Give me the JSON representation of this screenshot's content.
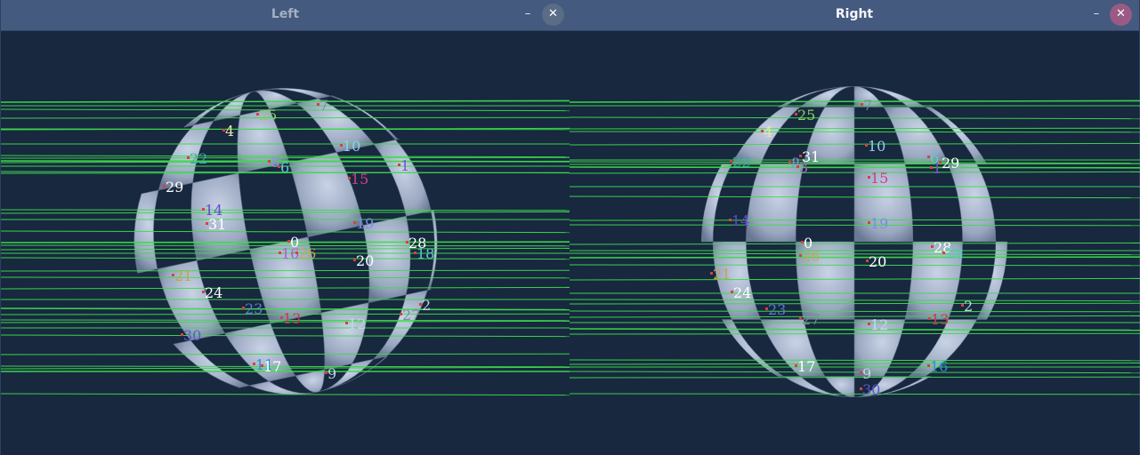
{
  "windows": {
    "left": {
      "title": "Left",
      "minimize_glyph": "–",
      "close_glyph": "✕",
      "points": [
        {
          "id": "7",
          "c": "#7f8aa4"
        },
        {
          "id": "25",
          "c": "#8ad15c"
        },
        {
          "id": "4",
          "c": "#e6e6a6"
        },
        {
          "id": "10",
          "c": "#8ecdf0"
        },
        {
          "id": "22",
          "c": "#3fa6b7"
        },
        {
          "id": "8",
          "c": "#8f8ee6"
        },
        {
          "id": "6",
          "c": "#5fc6d8"
        },
        {
          "id": "15",
          "c": "#d03e8a"
        },
        {
          "id": "1",
          "c": "#7b4fd6"
        },
        {
          "id": "29",
          "c": "#ffffff"
        },
        {
          "id": "14",
          "c": "#6846d6"
        },
        {
          "id": "31",
          "c": "#ffffff"
        },
        {
          "id": "19",
          "c": "#7a8fe4"
        },
        {
          "id": "0",
          "c": "#ffffff"
        },
        {
          "id": "16",
          "c": "#b05ad0"
        },
        {
          "id": "26",
          "c": "#c6a65a"
        },
        {
          "id": "28",
          "c": "#ffffff"
        },
        {
          "id": "18",
          "c": "#5fc6d8"
        },
        {
          "id": "20",
          "c": "#ffffff"
        },
        {
          "id": "21",
          "c": "#c8a248"
        },
        {
          "id": "24",
          "c": "#ffffff"
        },
        {
          "id": "23",
          "c": "#5f7ad8"
        },
        {
          "id": "13",
          "c": "#d0384c"
        },
        {
          "id": "12",
          "c": "#c7d4e6"
        },
        {
          "id": "27",
          "c": "#7f8aa4"
        },
        {
          "id": "2",
          "c": "#c7d4e6"
        },
        {
          "id": "30",
          "c": "#5a5ad0"
        },
        {
          "id": "11",
          "c": "#2f90d8"
        },
        {
          "id": "17",
          "c": "#ffffff"
        },
        {
          "id": "9",
          "c": "#c7d4e6"
        }
      ]
    },
    "right": {
      "title": "Right",
      "minimize_glyph": "–",
      "close_glyph": "✕",
      "points": [
        {
          "id": "7",
          "c": "#7f8aa4"
        },
        {
          "id": "25",
          "c": "#8ad15c"
        },
        {
          "id": "4",
          "c": "#e6e6a6"
        },
        {
          "id": "31",
          "c": "#ffffff"
        },
        {
          "id": "10",
          "c": "#8ecdf0"
        },
        {
          "id": "6",
          "c": "#5fc6d8"
        },
        {
          "id": "29",
          "c": "#ffffff"
        },
        {
          "id": "22",
          "c": "#3fa6b7"
        },
        {
          "id": "8",
          "c": "#8f8ee6"
        },
        {
          "id": "3",
          "c": "#b05ad0"
        },
        {
          "id": "15",
          "c": "#d03e8a"
        },
        {
          "id": "1",
          "c": "#7b4fd6"
        },
        {
          "id": "14",
          "c": "#6846d6"
        },
        {
          "id": "19",
          "c": "#7a8fe4"
        },
        {
          "id": "0",
          "c": "#ffffff"
        },
        {
          "id": "26",
          "c": "#c6a65a"
        },
        {
          "id": "20",
          "c": "#ffffff"
        },
        {
          "id": "28",
          "c": "#ffffff"
        },
        {
          "id": "18",
          "c": "#5fc6d8"
        },
        {
          "id": "21",
          "c": "#c8a248"
        },
        {
          "id": "24",
          "c": "#ffffff"
        },
        {
          "id": "23",
          "c": "#5f7ad8"
        },
        {
          "id": "27",
          "c": "#7f8aa4"
        },
        {
          "id": "12",
          "c": "#c7d4e6"
        },
        {
          "id": "13",
          "c": "#d0384c"
        },
        {
          "id": "2",
          "c": "#c7d4e6"
        },
        {
          "id": "17",
          "c": "#ffffff"
        },
        {
          "id": "9",
          "c": "#c7d4e6"
        },
        {
          "id": "16",
          "c": "#2f90d8"
        },
        {
          "id": "30",
          "c": "#5a5ad0"
        }
      ]
    }
  },
  "colors": {
    "line": "#3ddc4a",
    "sphere_light": "#c9d3e6",
    "sphere_dark": "#6a7894",
    "background": "#17283f"
  }
}
